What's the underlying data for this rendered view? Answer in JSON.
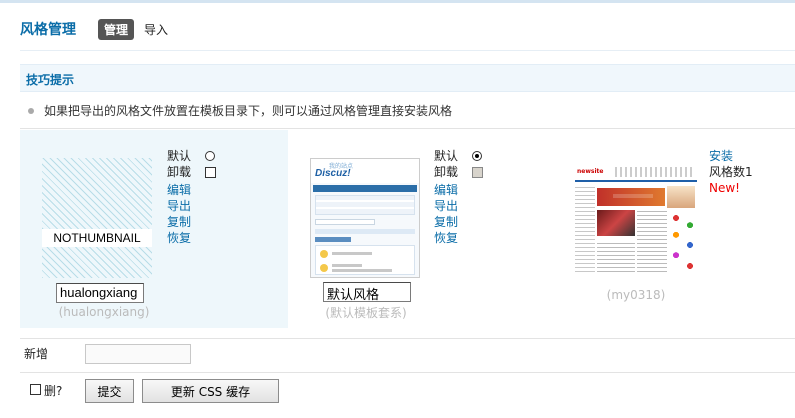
{
  "header": {
    "title": "风格管理",
    "tabs": [
      {
        "label": "管理",
        "active": true
      },
      {
        "label": "导入",
        "active": false
      }
    ]
  },
  "tips": {
    "title": "技巧提示",
    "items": [
      "如果把导出的风格文件放置在模板目录下，则可以通过风格管理直接安装风格"
    ]
  },
  "styles": [
    {
      "thumbnail_text": "NOTHUMBNAIL",
      "name_value": "hualongxiang",
      "directory": "(hualongxiang)",
      "default_label": "默认",
      "default_selected": false,
      "uninstall_label": "卸载",
      "uninstall_disabled": false,
      "actions": [
        "编辑",
        "导出",
        "复制",
        "恢复"
      ]
    },
    {
      "thumbnail_alt": "Discuz! 默认风格截图",
      "logo_text": "Discuz!",
      "logo_small": "我的站点",
      "name_value": "默认风格",
      "directory": "(默认模板套系)",
      "default_label": "默认",
      "default_selected": true,
      "uninstall_label": "卸载",
      "uninstall_disabled": true,
      "actions": [
        "编辑",
        "导出",
        "复制",
        "恢复"
      ]
    },
    {
      "logo_text": "newsite",
      "banner_text": "我的站点",
      "install_label": "安装",
      "style_count_label": "风格数1",
      "new_badge": "New!",
      "directory": "(my0318)"
    }
  ],
  "add": {
    "label": "新增",
    "value": ""
  },
  "footer": {
    "delete_label": "删?",
    "submit_label": "提交",
    "update_css_label": "更新 CSS 缓存"
  },
  "colors": {
    "accent": "#0b6da8",
    "new_badge": "#ee0000",
    "tips_bg": "#f0f7fc",
    "card_bg": "#eef7fb"
  }
}
